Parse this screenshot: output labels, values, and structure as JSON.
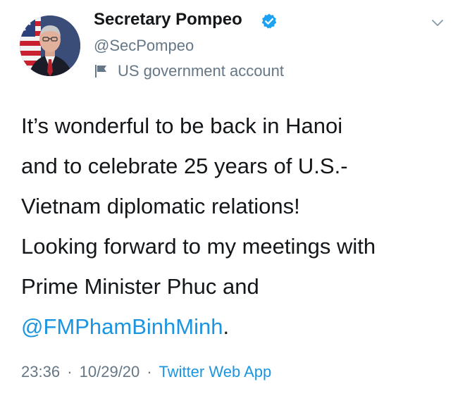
{
  "tweet": {
    "author": {
      "display_name": "Secretary Pompeo",
      "handle": "@SecPompeo",
      "verified": true,
      "account_label": "US government account"
    },
    "text_lines": [
      "It’s wonderful to be back in Hanoi",
      "and to celebrate 25 years of U.S.-",
      "Vietnam diplomatic relations!",
      "Looking forward to my meetings with",
      "Prime Minister Phuc and"
    ],
    "mention": "@FMPhamBinhMinh",
    "mention_suffix": ".",
    "time": "23:36",
    "date": "10/29/20",
    "separator": "·",
    "source": "Twitter Web App"
  },
  "icons": {
    "verified": "verified-badge-icon",
    "account_label": "flag-icon",
    "more": "chevron-down-icon"
  },
  "colors": {
    "text": "#14171a",
    "secondary": "#657786",
    "link": "#1b95e0",
    "verified": "#1da1f2"
  }
}
